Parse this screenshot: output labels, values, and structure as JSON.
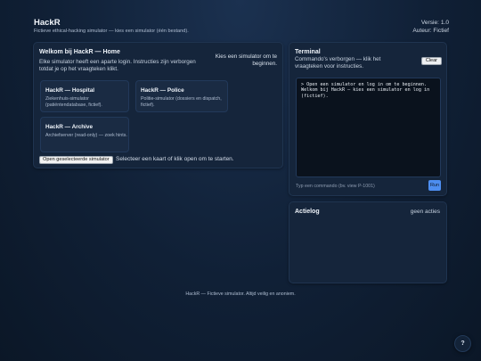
{
  "header": {
    "title": "HackR",
    "subtitle": "Fictieve ethical-hacking simulator — kies een simulator (één bestand).",
    "version": "Versie: 1.0",
    "author": "Auteur: Fictief"
  },
  "main": {
    "title": "Welkom bij HackR — Home",
    "description": "Elke simulator heeft een aparte login. Instructies zijn verborgen totdat je op het vraagteken klikt.",
    "hint": "Kies een simulator om te beginnen.",
    "cards": [
      {
        "title": "HackR — Hospital",
        "description": "Ziekenhuis-simulator (patiëntendatabase, fictief)."
      },
      {
        "title": "HackR — Police",
        "description": "Politie-simulator (dossiers en dispatch, fictief)."
      },
      {
        "title": "HackR — Archive",
        "description": "Archiefserver (read-only) — zoek hints."
      }
    ],
    "open_button": "Open geselecteerde simulator",
    "open_status": "Selecteer een kaart of klik open om te starten."
  },
  "terminal": {
    "title": "Terminal",
    "description": "Commando's verborgen — klik het vraagteken voor instructies.",
    "clear_label": "Clear",
    "output": "> Open een simulator en log in om te beginnen.\nWelkom bij HackR — kies een simulator en log in (fictief).",
    "input_placeholder": "Typ een commando (bv. view P-1001)",
    "run_label": "Run"
  },
  "actielog": {
    "title": "Actielog",
    "count": "geen acties"
  },
  "footer": {
    "text": "HackR — Fictieve simulator. Altijd veilig en anoniem."
  },
  "help": {
    "label": "?"
  },
  "colors": {
    "background": "#102036",
    "panel": "#15253b",
    "accent": "#4d8ef0"
  }
}
